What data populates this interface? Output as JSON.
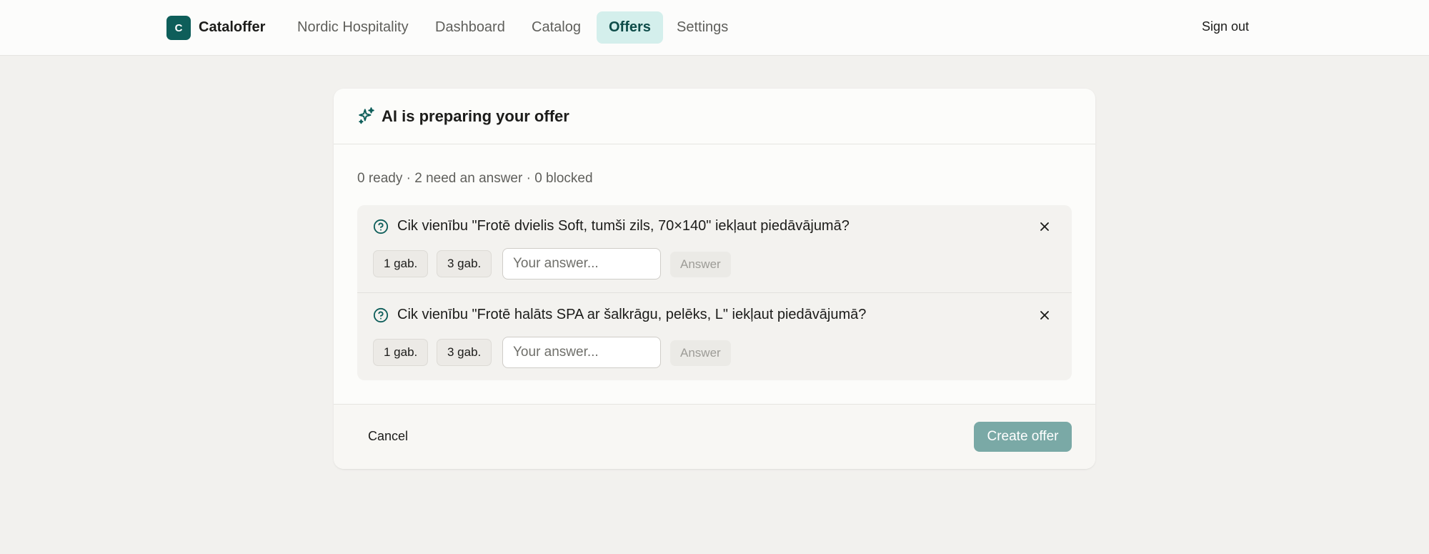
{
  "header": {
    "logo_letter": "C",
    "brand": "Cataloffer",
    "nav": [
      {
        "label": "Nordic Hospitality"
      },
      {
        "label": "Dashboard"
      },
      {
        "label": "Catalog"
      },
      {
        "label": "Offers",
        "active": true
      },
      {
        "label": "Settings"
      }
    ],
    "sign_out": "Sign out"
  },
  "dialog": {
    "title": "AI is preparing your offer",
    "summary": "0 ready · 2 need an answer · 0 blocked",
    "questions": [
      {
        "text": "Cik vienību \"Frotē dvielis Soft, tumši zils, 70×140\" iekļaut piedāvājumā?",
        "options": [
          "1 gab.",
          "3 gab."
        ],
        "input_placeholder": "Your answer...",
        "answer_label": "Answer"
      },
      {
        "text": "Cik vienību \"Frotē halāts SPA ar šalkrāgu, pelēks, L\" iekļaut piedāvājumā?",
        "options": [
          "1 gab.",
          "3 gab."
        ],
        "input_placeholder": "Your answer...",
        "answer_label": "Answer"
      }
    ],
    "cancel_label": "Cancel",
    "create_label": "Create offer"
  },
  "colors": {
    "accent": "#0e5e5a",
    "nav_active_bg": "#d4efec",
    "create_button_disabled": "#7aa9a6",
    "page_bg": "#f2f1ee"
  },
  "icons": {
    "card_title": "sparkles-icon",
    "question": "question-circle-icon",
    "dismiss": "close-icon"
  }
}
